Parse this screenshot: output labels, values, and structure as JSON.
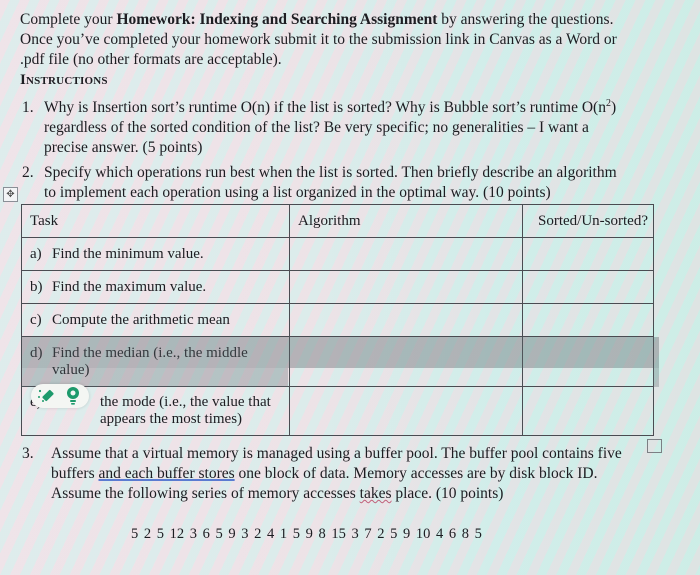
{
  "intro": {
    "line1_pre": "Complete your ",
    "line1_bold": "Homework: Indexing and Searching Assignment",
    "line1_post": " by answering the questions.",
    "line2": "Once you’ve completed your homework submit it to the submission link in Canvas as a Word or",
    "line3": ".pdf file (no other formats are acceptable)."
  },
  "instructions_heading": "Instructions",
  "questions": [
    {
      "number": "1.",
      "line1_pre": "Why is Insertion sort’s runtime O(n) if the list is sorted?  Why is Bubble sort’s runtime O(n",
      "line1_sup": "2",
      "line1_post": ")",
      "line2": "regardless of the sorted condition of the list? Be very specific; no generalities – I want a",
      "line3": "precise answer.  (5 points)"
    },
    {
      "number": "2.",
      "line1": "Specify which operations run best when the list is sorted. Then briefly describe an algorithm",
      "line2": "to implement each operation using a list organized in the optimal way. (10 points)"
    },
    {
      "number": "3.",
      "line1": "Assume that a virtual memory is managed using a buffer pool.  The buffer pool contains five",
      "line2_pre": "buffers ",
      "line2_underlined": "and each buffer stores",
      "line2_post": " one block of data.  Memory accesses are by disk block ID.",
      "line3_pre": "Assume the following series of memory accesses ",
      "line3_underlined": "takes",
      "line3_post": " place. (10 points)"
    }
  ],
  "table": {
    "headers": [
      "Task",
      "Algorithm",
      "Sorted/Un-sorted?"
    ],
    "rows": [
      {
        "label": "a)",
        "task": "Find the minimum value.",
        "algorithm": "",
        "sorted": ""
      },
      {
        "label": "b)",
        "task": "Find the maximum value.",
        "algorithm": "",
        "sorted": ""
      },
      {
        "label": "c)",
        "task": "Compute the arithmetic mean",
        "algorithm": "",
        "sorted": ""
      },
      {
        "label": "d)",
        "task": "Find the median (i.e., the middle value)",
        "algorithm": "",
        "sorted": ""
      },
      {
        "label": "e)",
        "task": "the mode (i.e., the value that appears the most times)",
        "algorithm": "",
        "sorted": ""
      }
    ]
  },
  "icons": {
    "table_move": "move-arrows-icon",
    "table_resize": "resize-handle-icon",
    "overlay_pen": "pen-sparkle-icon",
    "overlay_bulb": "lightbulb-icon"
  },
  "sequence": "5 2 5 12 3 6 5 9 3 2 4 1 5 9 8 15 3 7 2 5 9 10 4 6 8 5",
  "colors": {
    "text": "#1d1d22",
    "overlay_icon_green": "#1d9a6c",
    "underline_blue": "#5b7bd1",
    "underline_red": "#c0607a"
  }
}
